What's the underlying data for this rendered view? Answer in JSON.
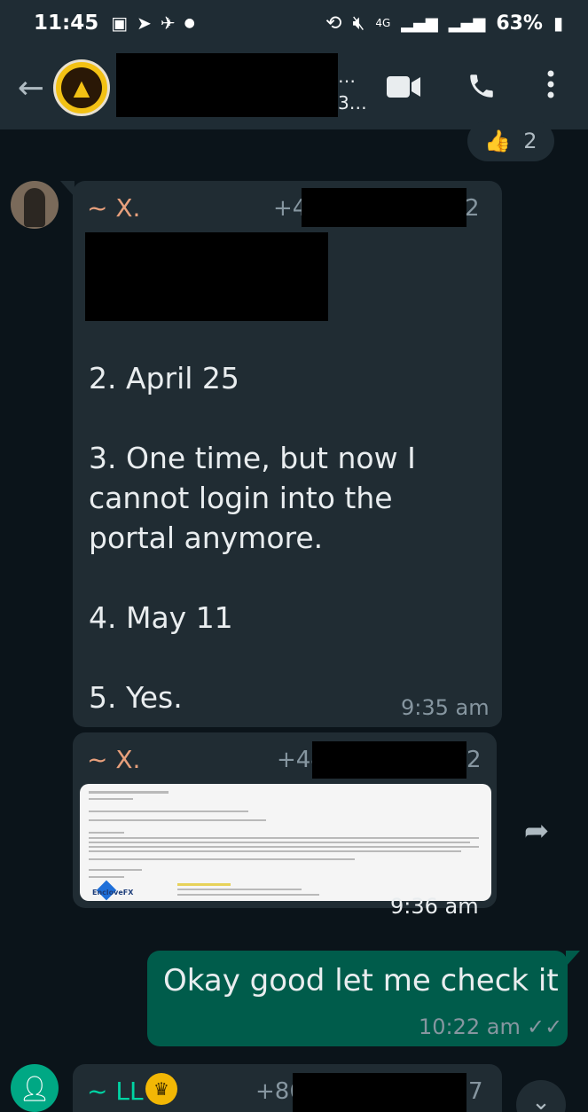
{
  "status_bar": {
    "time": "11:45",
    "network": "4G",
    "battery": "63%"
  },
  "header": {
    "ellipsis": "…",
    "subtitle": "3…"
  },
  "reaction": {
    "emoji": "👍",
    "count": "2"
  },
  "messages": [
    {
      "sender": "~ X.",
      "phone_prefix": "+4",
      "phone_suffix": "2",
      "text": "2. April 25\n\n3. One time, but now I cannot login into the portal anymore.\n\n4. May 11\n\n5. Yes.",
      "time": "9:35 am"
    },
    {
      "sender": "~ X.",
      "phone_prefix": "+44",
      "phone_suffix": "2",
      "time": "9:36 am",
      "image": {
        "brand": "EncloveFX"
      }
    }
  ],
  "outgoing": {
    "text": "Okay good let me check it",
    "time": "10:22 am"
  },
  "last_message": {
    "sender": "~ LL",
    "phone_prefix": "+86",
    "phone_suffix": "7"
  }
}
